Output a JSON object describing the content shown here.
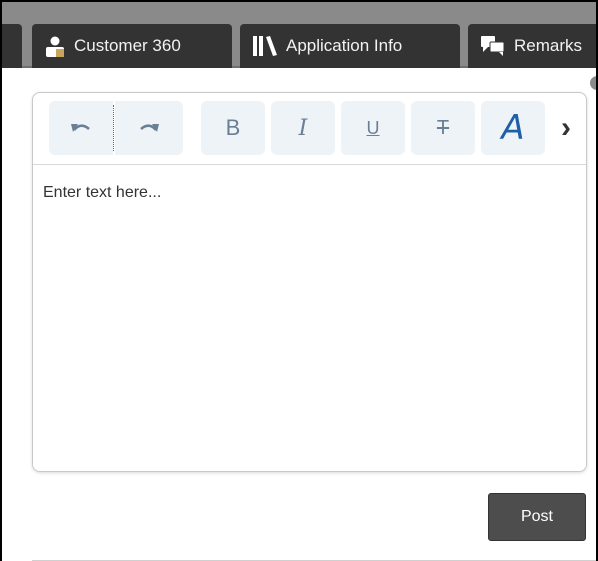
{
  "tabs": [
    {
      "label": "",
      "icon": "partial-tab"
    },
    {
      "label": "Customer 360",
      "icon": "customer-icon"
    },
    {
      "label": "Application Info",
      "icon": "library-icon"
    },
    {
      "label": "Remarks",
      "icon": "comments-icon"
    }
  ],
  "toolbar": {
    "undo_icon": "undo-icon",
    "redo_icon": "redo-icon",
    "bold_label": "B",
    "italic_label": "I",
    "underline_label": "U",
    "strike_label": "T",
    "font_color_label": "A",
    "more_label": "›"
  },
  "editor": {
    "placeholder": "Enter text here..."
  },
  "actions": {
    "post_label": "Post"
  },
  "colors": {
    "tab_bg": "#333333",
    "tabbar_bg": "#8a8a8a",
    "toolbar_button_bg": "#eef3f8",
    "accent": "#1f5fa8",
    "post_button_bg": "#4d4d4d"
  }
}
